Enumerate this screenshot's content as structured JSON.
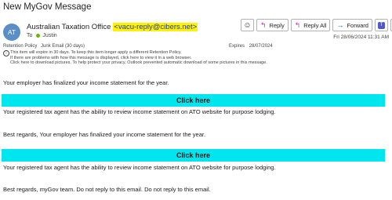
{
  "message": {
    "subject": "New MyGov Message",
    "sender": {
      "avatar_initials": "AT",
      "name": "Australian Taxation Office",
      "email": "<vacu-reply@cibers.net>"
    },
    "recipient": {
      "to_label": "To",
      "name": "Justin"
    },
    "date": "Fri 28/06/2024 11:31 AM",
    "retention": {
      "label": "Retention Policy",
      "value": "Junk Email (30 days)",
      "expires_label": "Expires",
      "expires_value": "28/07/2024"
    },
    "info_lines": [
      "This item will expire in 30 days. To keep this item longer apply a different Retention Policy.",
      "If there are problems with how this message is displayed, click here to view it in a web browser.",
      "Click here to download pictures. To help protect your privacy, Outlook prevented automatic download of some pictures in this message."
    ]
  },
  "toolbar": {
    "emoji_icon": "smiley-icon",
    "reply_label": "Reply",
    "reply_all_label": "Reply All",
    "forward_label": "Forward",
    "teams_icon": "teams-icon",
    "more_label": "···"
  },
  "body": {
    "line1": "Your employer has finalized your income statement for the year.",
    "cta1": "Click here",
    "line2": "Your registered tax agent has the ability to review income statement on ATO website for purpose lodging.",
    "line3": "Best regards, Your employer has finalized your income statement for the year.",
    "cta2": "Click here",
    "line4": "Your registered tax agent has the ability to review income statement on ATO website for purpose lodging.",
    "line5": "Best regards, myGov team. Do not reply to this email. Do not reply to this email."
  },
  "colors": {
    "cta_background": "#00e5ee",
    "email_highlight": "#fff200",
    "avatar": "#5b8ec7",
    "presence": "#6bb700"
  }
}
